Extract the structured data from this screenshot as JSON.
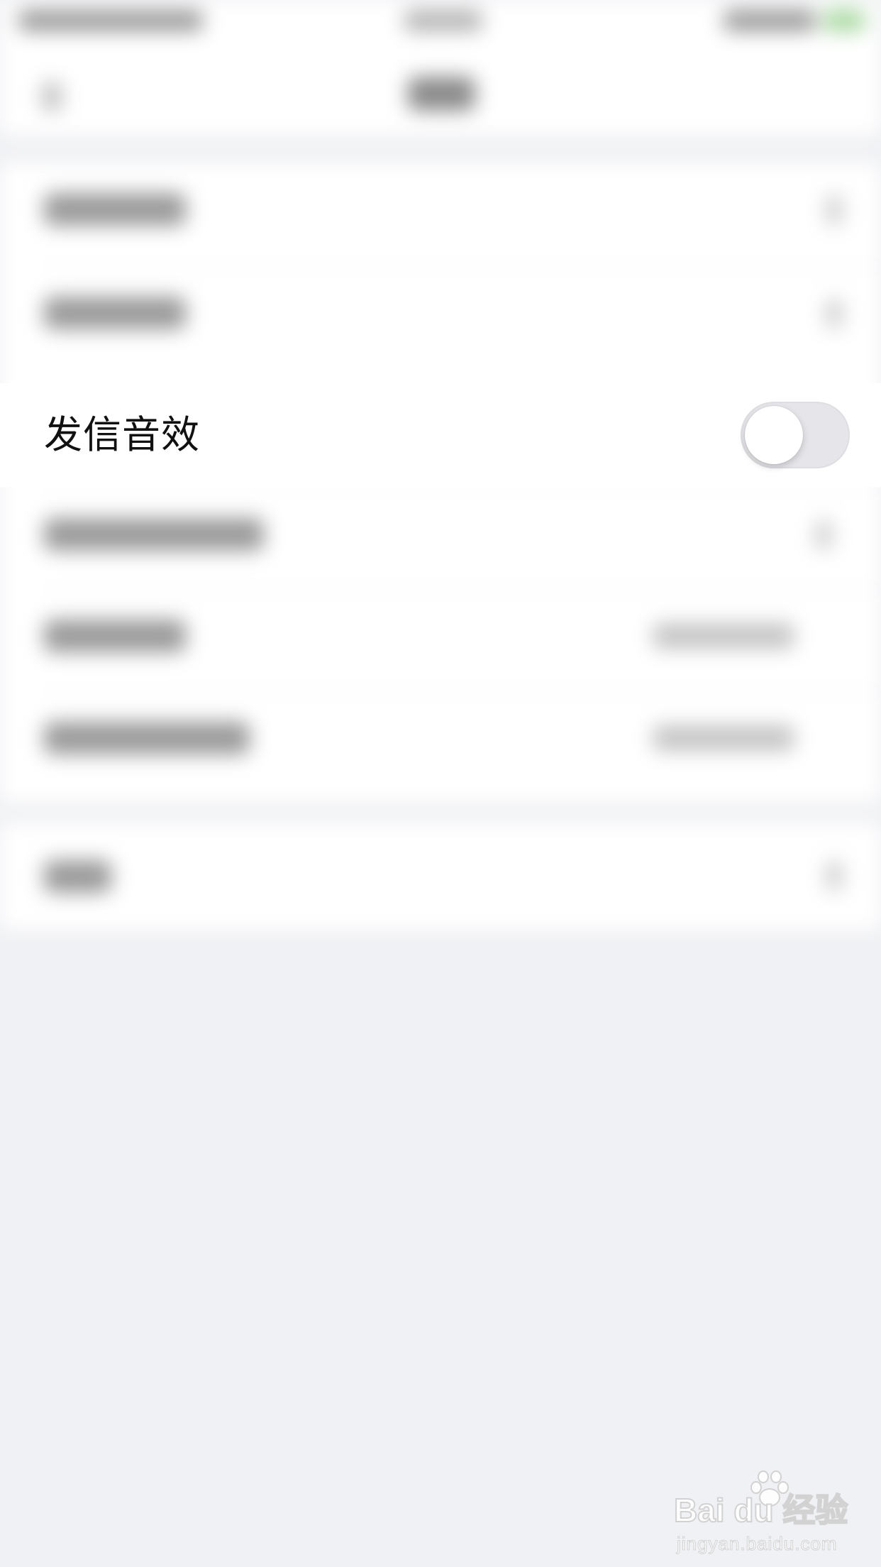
{
  "settings_row": {
    "label": "发信音效",
    "toggle_on": false
  },
  "watermark": {
    "brand": "Bai du 经验",
    "url": "jingyan.baidu.com"
  },
  "colors": {
    "page_background": "#f0f1f4",
    "row_background": "#ffffff",
    "toggle_off_track": "#e6e6ea",
    "toggle_knob": "#ffffff"
  }
}
